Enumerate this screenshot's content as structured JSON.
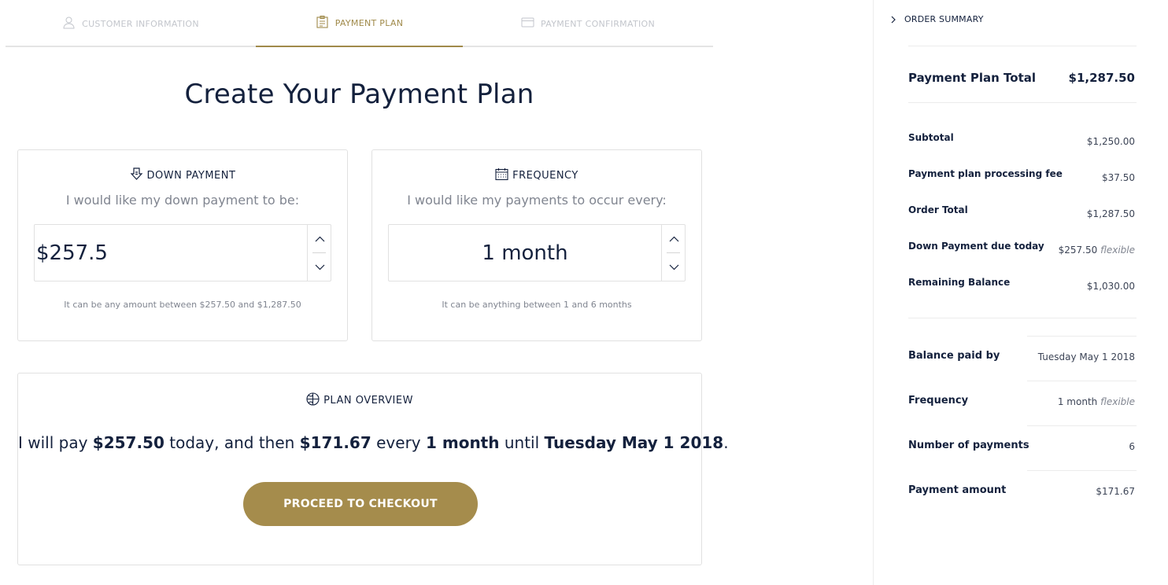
{
  "steps": {
    "customer": "CUSTOMER INFORMATION",
    "plan": "PAYMENT PLAN",
    "confirmation": "PAYMENT CONFIRMATION"
  },
  "page_title": "Create Your Payment Plan",
  "down_payment": {
    "heading": "DOWN PAYMENT",
    "subtitle": "I would like my down payment to be:",
    "value": "$257.5",
    "hint": "It can be any amount between $257.50 and $1,287.50"
  },
  "frequency": {
    "heading": "FREQUENCY",
    "subtitle": "I would like my payments to occur every:",
    "value": "1 month",
    "hint": "It can be anything between 1 and 6 months"
  },
  "plan_overview": {
    "heading": "PLAN OVERVIEW",
    "t1": "I will pay ",
    "b1": "$257.50",
    "t2": " today, and then ",
    "b2": "$171.67",
    "t3": " every ",
    "b3": "1 month",
    "t4": " until ",
    "b4": "Tuesday May 1 2018",
    "t5": ".",
    "cta": "PROCEED TO CHECKOUT"
  },
  "sidebar": {
    "toggle": "ORDER SUMMARY",
    "total_label": "Payment Plan Total",
    "total_value": "$1,287.50",
    "subtotal_label": "Subtotal",
    "subtotal_value": "$1,250.00",
    "fee_label": "Payment plan processing fee",
    "fee_value": "$37.50",
    "order_total_label": "Order Total",
    "order_total_value": "$1,287.50",
    "down_label": "Down Payment due today",
    "down_value": "$257.50",
    "down_note": "flexible",
    "remaining_label": "Remaining Balance",
    "remaining_value": "$1,030.00",
    "paid_by_label": "Balance paid by",
    "paid_by_value": "Tuesday May 1 2018",
    "freq_label": "Frequency",
    "freq_value": "1 month",
    "freq_note": "flexible",
    "num_label": "Number of payments",
    "num_value": "6",
    "amount_label": "Payment amount",
    "amount_value": "$171.67"
  },
  "colors": {
    "accent": "#a58c4c",
    "text": "#14213d",
    "muted": "#808590",
    "border": "#e1e1e1"
  }
}
